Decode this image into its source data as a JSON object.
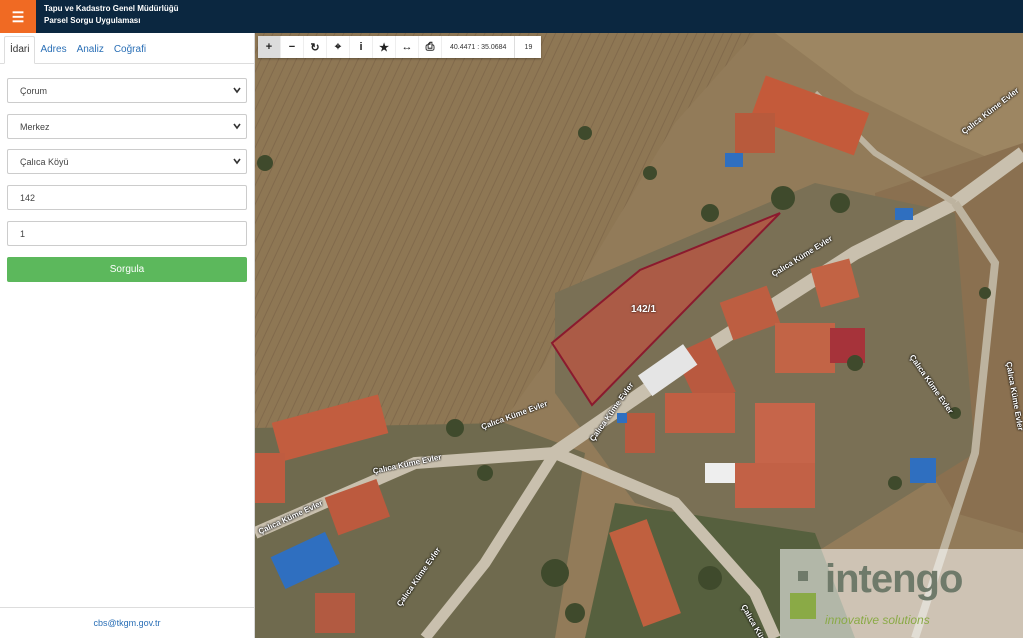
{
  "header": {
    "menu_icon": "hamburger-icon",
    "title_line1": "Tapu ve Kadastro Genel Müdürlüğü",
    "title_line2": "Parsel Sorgu Uygulaması",
    "bg_color": "#0b2740",
    "accent_color": "#f06a23"
  },
  "sidebar": {
    "tabs": [
      {
        "label": "İdari",
        "active": true
      },
      {
        "label": "Adres",
        "active": false
      },
      {
        "label": "Analiz",
        "active": false
      },
      {
        "label": "Coğrafi",
        "active": false
      }
    ],
    "province": "Çorum",
    "district": "Merkez",
    "village": "Çalıca Köyü",
    "block": "142",
    "parcel": "1",
    "query_button": "Sorgula",
    "query_button_color": "#5cb85c",
    "footer_email": "cbs@tkgm.gov.tr"
  },
  "map": {
    "toolbar_icons": [
      "zoom-in-icon",
      "zoom-out-icon",
      "refresh-icon",
      "locate-icon",
      "info-icon",
      "star-icon",
      "measure-icon",
      "print-icon"
    ],
    "coordinates": "40.4471 : 35.0684",
    "zoom_level": "19",
    "parcel_label": "142/1",
    "parcel_outline_color": "#8b1a2e",
    "street_labels": [
      "Çalıca Küme Evler",
      "Çalıca Küme Evler",
      "Çalıca Küme Evler",
      "Çalıca Küme Evler",
      "Çalıca Küme Evler",
      "Çalıca Küme Evler",
      "Çalıca Küme Evler",
      "Çalıca Küme Evler",
      "Çalıca Küme Evler",
      "Çalıca Küme Evler"
    ],
    "watermark_logo": "intengo",
    "watermark_sub": "innovative solutions"
  }
}
